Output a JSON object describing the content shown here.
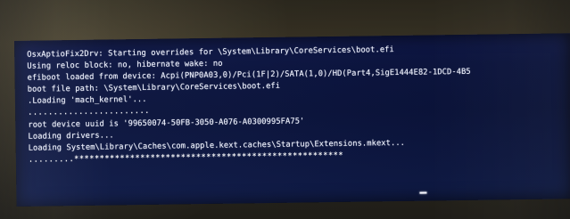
{
  "screen": {
    "lines": [
      "OsxAptioFix2Drv: Starting overrides for \\System\\Library\\CoreServices\\boot.efi",
      "Using reloc block: no, hibernate wake: no",
      "efiboot loaded from device: Acpi(PNP0A03,0)/Pci(1F|2)/SATA(1,0)/HD(Part4,SigE1444E82-1DCD-4B5",
      "boot file path: \\System\\Library\\CoreServices\\boot.efi",
      ".Loading 'mach_kernel'...",
      "........................",
      "root device uuid is '99650074-50FB-3050-A076-A0300995FA75'",
      "Loading drivers...",
      "Loading System\\Library\\Caches\\com.apple.kext.caches\\Startup\\Extensions.mkext...",
      ".........*****************************************************"
    ]
  }
}
